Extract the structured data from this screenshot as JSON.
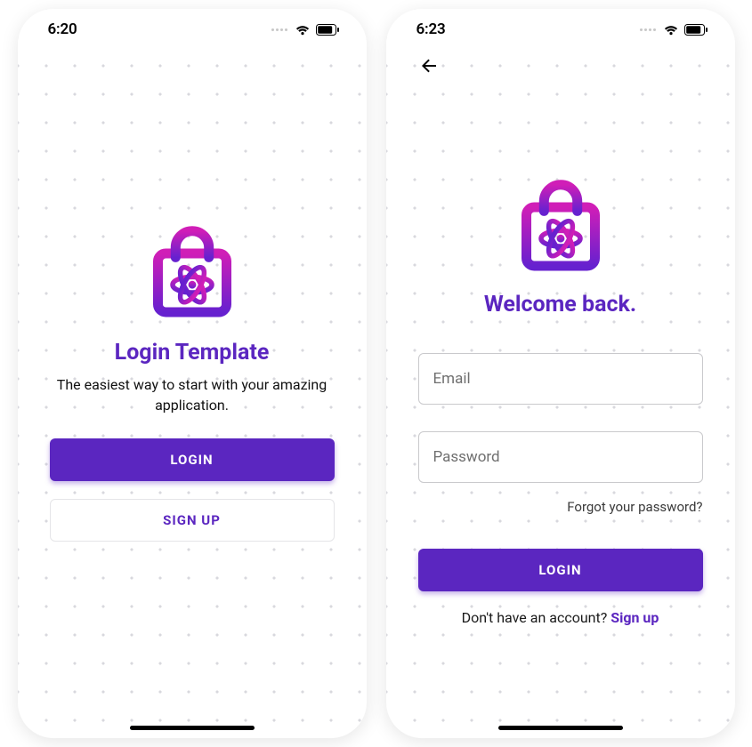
{
  "screen1": {
    "statusbar": {
      "time": "6:20"
    },
    "title": "Login Template",
    "subtitle": "The easiest way to start with your amazing application.",
    "login_button": "LOGIN",
    "signup_button": "SIGN UP"
  },
  "screen2": {
    "statusbar": {
      "time": "6:23"
    },
    "title": "Welcome back.",
    "email_placeholder": "Email",
    "password_placeholder": "Password",
    "forgot": "Forgot your password?",
    "login_button": "LOGIN",
    "signup_prompt": "Don't have an account? ",
    "signup_link": "Sign up"
  },
  "colors": {
    "primary": "#5b26c0",
    "gradient_top": "#d01eb7",
    "gradient_bottom": "#6621cf"
  },
  "icons": {
    "logo": "shopping-bag-react-icon",
    "back": "arrow-left-icon",
    "wifi": "wifi-icon",
    "battery": "battery-icon"
  }
}
